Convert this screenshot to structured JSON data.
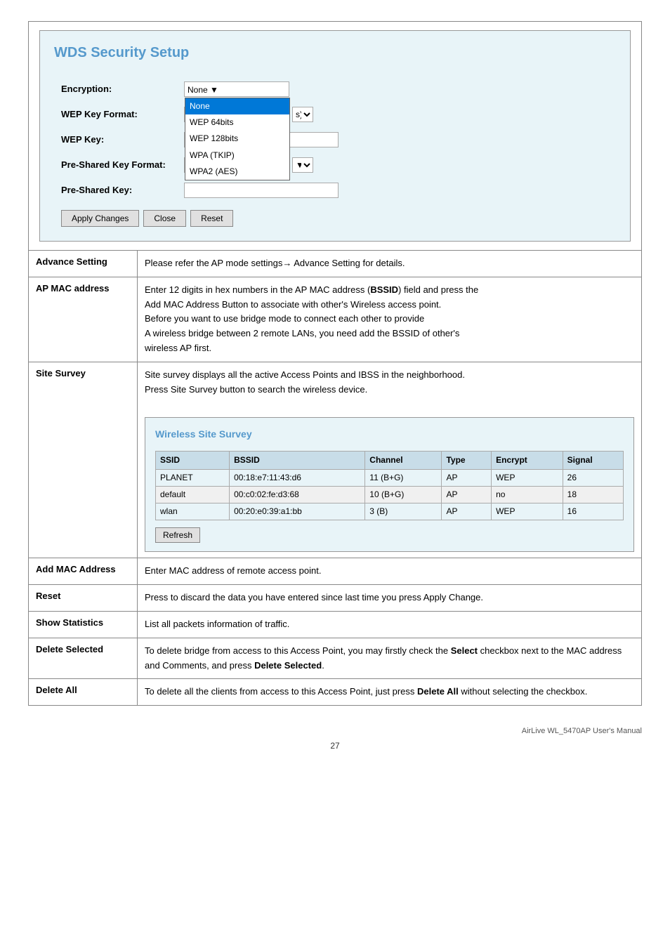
{
  "wds": {
    "title": "WDS Security Setup",
    "fields": {
      "encryption_label": "Encryption:",
      "wep_key_format_label": "WEP Key Format:",
      "wep_key_label": "WEP Key:",
      "pre_shared_key_format_label": "Pre-Shared Key Format:",
      "pre_shared_key_label": "Pre-Shared Key:"
    },
    "encryption_options": [
      "None",
      "WEP 64bits",
      "WEP 128bits",
      "WPA (TKIP)",
      "WPA2 (AES)"
    ],
    "encryption_selected": "None",
    "buttons": {
      "apply": "Apply Changes",
      "close": "Close",
      "reset": "Reset"
    }
  },
  "table": {
    "rows": [
      {
        "label": "Advance Setting",
        "content": "Please refer the AP mode settings→ Advance Setting for details."
      },
      {
        "label": "AP MAC address",
        "content_parts": [
          "Enter 12 digits in hex numbers in the AP MAC address (BSSID) field and press the",
          "Add MAC Address Button to associate with other's Wireless access point.",
          "Before you want to use bridge mode to connect each other to provide",
          "A wireless bridge between 2 remote LANs, you need add the BSSID of other's",
          "wireless AP first."
        ]
      },
      {
        "label": "Site Survey",
        "intro": [
          "Site survey displays all the active Access Points and IBSS in the neighborhood.",
          "Press Site Survey button to search the wireless device."
        ],
        "survey_title": "Wireless Site Survey",
        "survey_columns": [
          "SSID",
          "BSSID",
          "Channel",
          "Type",
          "Encrypt",
          "Signal"
        ],
        "survey_rows": [
          {
            "ssid": "PLANET",
            "bssid": "00:18:e7:11:43:d6",
            "channel": "11 (B+G)",
            "type": "AP",
            "encrypt": "WEP",
            "signal": "26"
          },
          {
            "ssid": "default",
            "bssid": "00:c0:02:fe:d3:68",
            "channel": "10 (B+G)",
            "type": "AP",
            "encrypt": "no",
            "signal": "18"
          },
          {
            "ssid": "wlan",
            "bssid": "00:20:e0:39:a1:bb",
            "channel": "3 (B)",
            "type": "AP",
            "encrypt": "WEP",
            "signal": "16"
          }
        ],
        "refresh_label": "Refresh"
      },
      {
        "label": "Add MAC Address",
        "content": "Enter MAC address of remote access point."
      },
      {
        "label": "Reset",
        "content": "Press to discard the data you have entered since last time you press Apply Change."
      },
      {
        "label": "Show Statistics",
        "content": "List all packets information of traffic."
      },
      {
        "label": "Delete Selected",
        "content_html": "To delete bridge from access to this Access Point, you may firstly check the <b>Select</b> checkbox next to the MAC address and Comments, and press <b>Delete Selected</b>."
      },
      {
        "label": "Delete All",
        "content_html": "To delete all the clients from access to this Access Point, just press <b>Delete All</b> without selecting the checkbox."
      }
    ]
  },
  "footer": {
    "manual": "AirLive WL_5470AP User's Manual",
    "page": "27"
  }
}
